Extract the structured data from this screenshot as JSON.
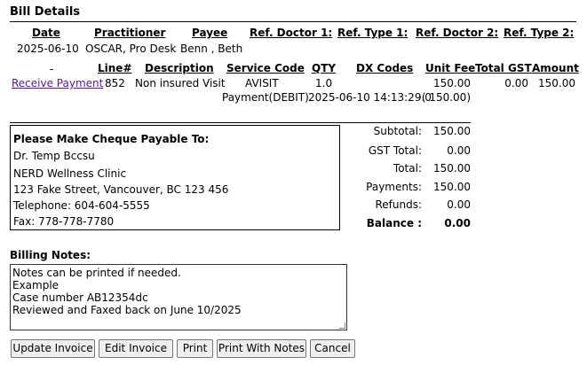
{
  "section_title": "Bill Details",
  "header": {
    "cols": [
      "Date",
      "Practitioner",
      "Payee",
      "Ref. Doctor 1:",
      "Ref. Type 1:",
      "Ref. Doctor 2:",
      "Ref. Type 2:"
    ],
    "values": {
      "date": "2025-06-10",
      "practitioner": "OSCAR, Pro Desk",
      "payee": "Benn , Beth"
    }
  },
  "items": {
    "dash": "-",
    "cols": [
      "Line#",
      "Description",
      "Service Code",
      "QTY",
      "DX Codes",
      "Unit Fee",
      "Total GST",
      "Amount"
    ],
    "row": {
      "action": "Receive Payment",
      "line": "852",
      "description": "Non insured Visit",
      "service_code": "AVISIT",
      "qty": "1.0",
      "unit_fee": "150.00",
      "total_gst": "0.00",
      "amount": "150.00"
    },
    "payment": {
      "label": "Payment(DEBIT)",
      "datetime": "2025-06-10 14:13:29.0",
      "amount": "( 150.00)"
    }
  },
  "cheque": {
    "title": "Please Make Cheque Payable To:",
    "lines": [
      "Dr. Temp Bccsu",
      "NERD Wellness Clinic",
      "123 Fake Street, Vancouver, BC 123 456",
      "Telephone: 604-604-5555",
      "Fax: 778-778-7780"
    ]
  },
  "totals": {
    "subtotal_label": "Subtotal:",
    "subtotal": "150.00",
    "gst_label": "GST Total:",
    "gst": "0.00",
    "total_label": "Total:",
    "total": "150.00",
    "payments_label": "Payments:",
    "payments": "150.00",
    "refunds_label": "Refunds:",
    "refunds": "0.00",
    "balance_label": "Balance :",
    "balance": "0.00"
  },
  "billing_notes": {
    "label": "Billing Notes:",
    "lines": [
      "Notes can be printed if needed.",
      "Example",
      "Case number AB12354dc",
      "Reviewed and Faxed back on June 10/2025"
    ]
  },
  "buttons": {
    "update_invoice": "Update Invoice",
    "edit_invoice": "Edit Invoice",
    "print": "Print",
    "print_with_notes": "Print With Notes",
    "cancel": "Cancel"
  }
}
